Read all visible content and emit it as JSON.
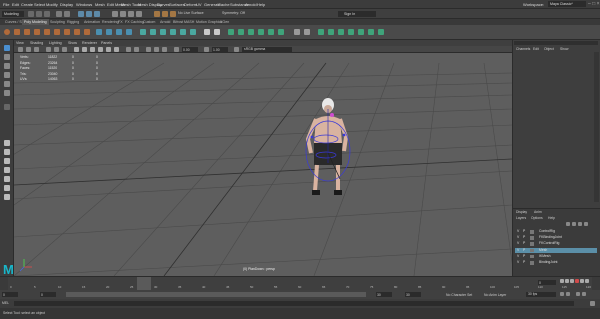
{
  "menubar": {
    "items": [
      "File",
      "Edit",
      "Create",
      "Select",
      "Modify",
      "Display",
      "Windows",
      "Mesh",
      "Edit Mesh",
      "Mesh Tools",
      "Mesh Display",
      "Curves",
      "Surfaces",
      "Deform",
      "UV",
      "Generate",
      "Cache",
      "Substance",
      "Arnold",
      "Help"
    ],
    "workspace_label": "Workspace:",
    "workspace_value": "Maya Classic*"
  },
  "statusline": {
    "mode": "Modeling",
    "sign_in": "Sign In",
    "no_live_surface": "No Live Surface",
    "symmetry": "Symmetry: Off"
  },
  "shelf_tabs": [
    "Curves / Surfaces",
    "Poly Modeling",
    "Sculpting",
    "Rigging",
    "Animation",
    "Rendering",
    "FX",
    "FX Caching",
    "Custom",
    "Arnold",
    "Bifrost",
    "MASH",
    "Motion Graphics",
    "XGen"
  ],
  "shelf_active": "Poly Modeling",
  "panel_menu": [
    "View",
    "Shading",
    "Lighting",
    "Show",
    "Renderer",
    "Panels"
  ],
  "panel_tools": {
    "value1": "0.00",
    "value2": "1.00",
    "color_space": "sRGB gamma"
  },
  "hud": {
    "rows": [
      {
        "label": "Verts:",
        "v1": "11822",
        "v2": "0",
        "v3": "0"
      },
      {
        "label": "Edges:",
        "v1": "23264",
        "v2": "0",
        "v3": "0"
      },
      {
        "label": "Faces:",
        "v1": "11520",
        "v2": "0",
        "v3": "0"
      },
      {
        "label": "Tris:",
        "v1": "23040",
        "v2": "0",
        "v3": "0"
      },
      {
        "label": "UVs:",
        "v1": "14063",
        "v2": "0",
        "v3": "0"
      }
    ]
  },
  "camera_label": "(0) PlanDown : persp",
  "channel_box_tabs": [
    "Channels",
    "Edit",
    "Object",
    "Show"
  ],
  "layer_tabs": [
    "Display",
    "Anim"
  ],
  "layer_menu": [
    "Layers",
    "Options",
    "Help"
  ],
  "layers": [
    {
      "name": "ControlRig",
      "selected": false
    },
    {
      "name": "FKBindingJoint",
      "selected": false
    },
    {
      "name": "FKControlRig",
      "selected": false
    },
    {
      "name": "Mesh",
      "selected": true
    },
    {
      "name": "IKMesh",
      "selected": false
    },
    {
      "name": "BindingJoint",
      "selected": false
    }
  ],
  "timeline": {
    "ticks": [
      "0",
      "5",
      "10",
      "15",
      "20",
      "25",
      "30",
      "35",
      "40",
      "45",
      "50",
      "55",
      "60",
      "65",
      "70",
      "75",
      "80",
      "85",
      "90",
      "95",
      "100",
      "105",
      "110",
      "115",
      "120"
    ],
    "current_frame": "0"
  },
  "range": {
    "start": "0",
    "start2": "0",
    "end": "30",
    "end2": "30",
    "no_character_set": "No Character Set",
    "no_anim_layer": "No Anim Layer",
    "fps": "30 fps"
  },
  "command": {
    "label": "MEL"
  },
  "help_text": "Select Tool: select an object",
  "colors": {
    "viewport_bg": "#5e5e5e",
    "selected_layer": "#5b8fa8",
    "maya_logo": "#19b6c9"
  }
}
